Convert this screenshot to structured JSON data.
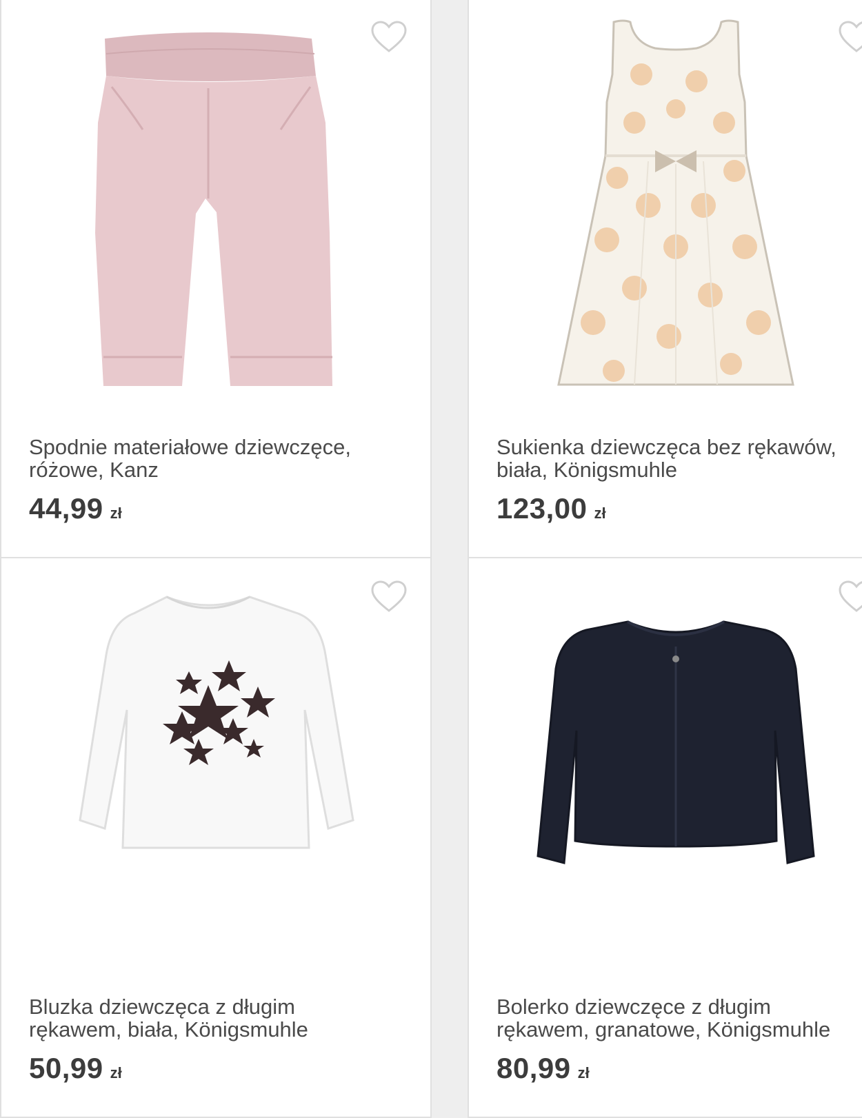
{
  "colors": {
    "background": "#eeeeee",
    "card": "#ffffff",
    "text": "#4a4a4a",
    "heart": "#cfcfcf"
  },
  "products": [
    {
      "title_line1": "Spodnie materiałowe dziewczęce,",
      "title_line2": "różowe, Kanz",
      "price": "44,99",
      "currency": "zł",
      "icon": "heart-outline-icon"
    },
    {
      "title_line1": "Sukienka dziewczęca bez rękawów,",
      "title_line2": "biała, Königsmuhle",
      "price": "123,00",
      "currency": "zł",
      "icon": "heart-outline-icon"
    },
    {
      "title_line1": "Bluzka dziewczęca z długim",
      "title_line2": "rękawem, biała, Königsmuhle",
      "price": "50,99",
      "currency": "zł",
      "icon": "heart-outline-icon"
    },
    {
      "title_line1": "Bolerko dziewczęce z długim",
      "title_line2": "rękawem, granatowe, Königsmuhle",
      "price": "80,99",
      "currency": "zł",
      "icon": "heart-outline-icon"
    }
  ]
}
